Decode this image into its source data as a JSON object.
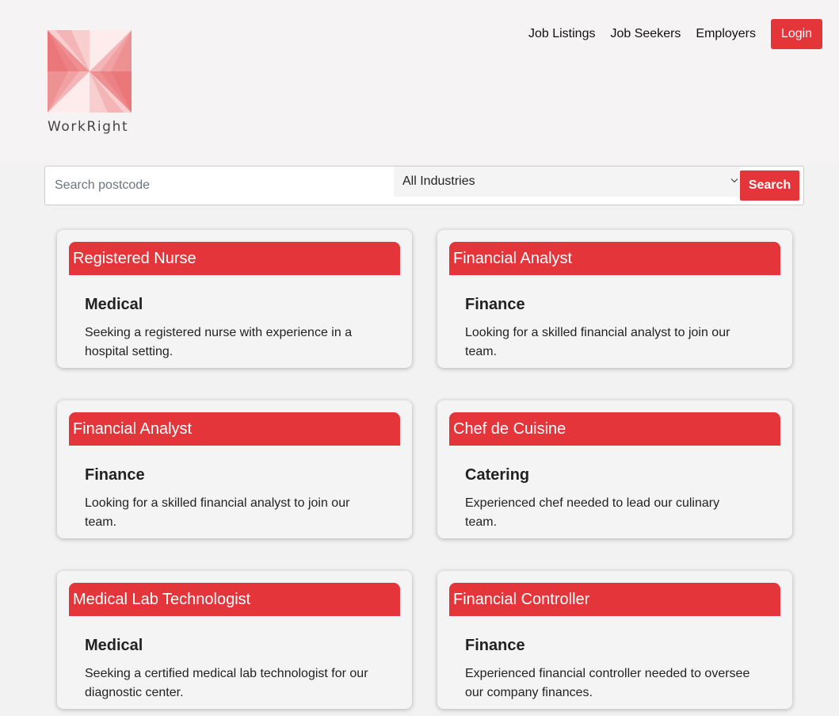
{
  "brand": {
    "name": "WorkRight",
    "colors": {
      "accent": "#e3353a",
      "logo_light": "#f7c9c8",
      "logo_dark": "#e2494c"
    }
  },
  "nav": {
    "links": [
      "Job Listings",
      "Job Seekers",
      "Employers"
    ],
    "login_label": "Login"
  },
  "search": {
    "placeholder": "Search postcode",
    "value": "",
    "industry_selected": "All Industries",
    "button_label": "Search"
  },
  "jobs": [
    {
      "title": "Registered Nurse",
      "industry": "Medical",
      "description": "Seeking a registered nurse with experience in a hospital setting."
    },
    {
      "title": "Financial Analyst",
      "industry": "Finance",
      "description": "Looking for a skilled financial analyst to join our team."
    },
    {
      "title": "Financial Analyst",
      "industry": "Finance",
      "description": "Looking for a skilled financial analyst to join our team."
    },
    {
      "title": "Chef de Cuisine",
      "industry": "Catering",
      "description": "Experienced chef needed to lead our culinary team."
    },
    {
      "title": "Medical Lab Technologist",
      "industry": "Medical",
      "description": "Seeking a certified medical lab technologist for our diagnostic center."
    },
    {
      "title": "Financial Controller",
      "industry": "Finance",
      "description": "Experienced financial controller needed to oversee our company finances."
    }
  ]
}
